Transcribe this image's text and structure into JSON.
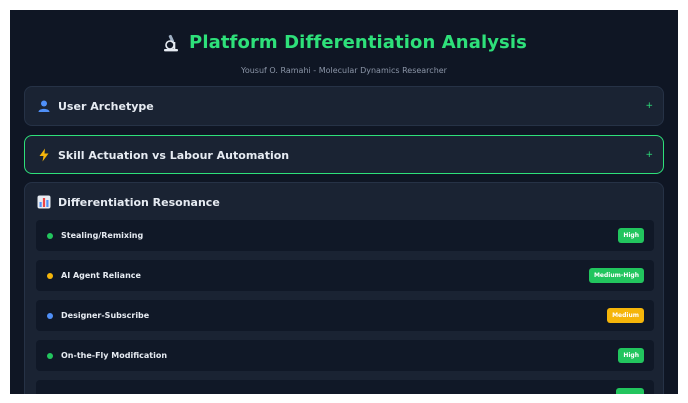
{
  "header": {
    "title": "Platform Differentiation Analysis",
    "subtitle": "Yousuf O. Ramahi - Molecular Dynamics Researcher",
    "title_icon": "microscope-icon"
  },
  "sections": {
    "archetype": {
      "label": "User Archetype",
      "icon": "user-icon",
      "toggle": "+"
    },
    "skill": {
      "label": "Skill Actuation vs Labour Automation",
      "icon": "lightning-icon",
      "toggle": "+"
    },
    "resonance": {
      "label": "Differentiation Resonance",
      "icon": "bar-chart-icon"
    }
  },
  "resonance_items": [
    {
      "label": "Stealing/Remixing",
      "level": "High",
      "dot_color": "#22c55e",
      "badge_color": "#22c55e"
    },
    {
      "label": "AI Agent Reliance",
      "level": "Medium-High",
      "dot_color": "#f5b50a",
      "badge_color": "#22c55e"
    },
    {
      "label": "Designer-Subscribe",
      "level": "Medium",
      "dot_color": "#4f8ff7",
      "badge_color": "#f5b50a"
    },
    {
      "label": "On-the-Fly Modification",
      "level": "High",
      "dot_color": "#22c55e",
      "badge_color": "#22c55e"
    },
    {
      "label": "",
      "level": "",
      "dot_color": "",
      "badge_color": "#22c55e"
    }
  ],
  "colors": {
    "accent": "#2ee07a",
    "background": "#0f1624",
    "card": "#1a2333"
  }
}
